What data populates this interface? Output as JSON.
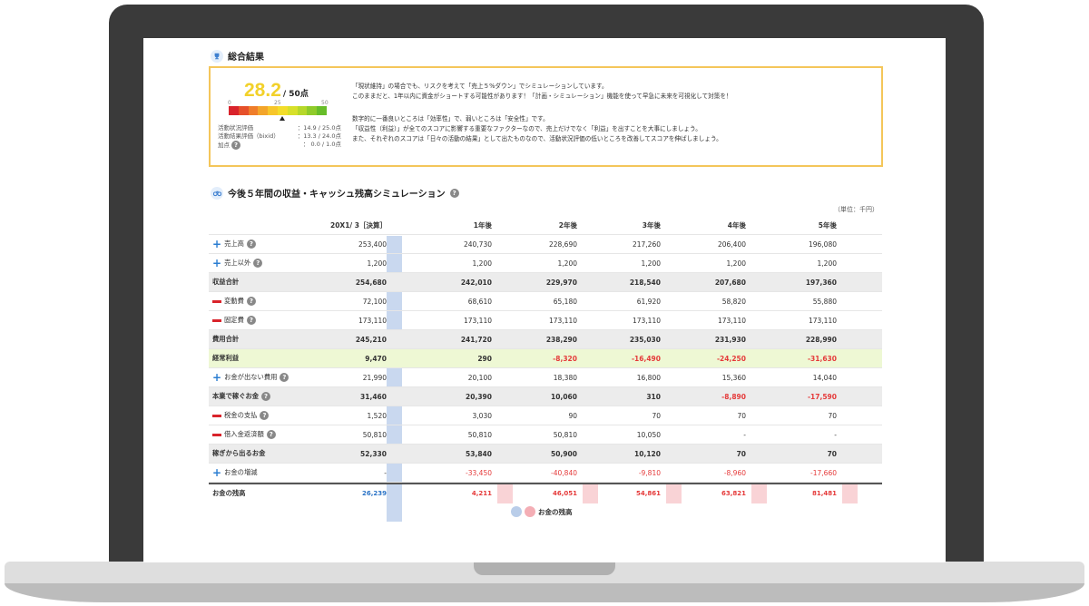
{
  "summary": {
    "section_title": "総合結果",
    "score": "28.2",
    "score_max": "/ 50点",
    "gauge_labels": [
      "0",
      "25",
      "50"
    ],
    "gauge_colors": [
      "#d9232b",
      "#e6502a",
      "#ef7d2a",
      "#f3a52a",
      "#f7c62a",
      "#f3dd2a",
      "#d7e02a",
      "#b6d82a",
      "#8fcb2a",
      "#67bd2a"
    ],
    "stats": [
      {
        "label": "活動状況評価",
        "value": "：14.9 / 25.0点"
      },
      {
        "label": "活動結果評価（bixid）",
        "value": "：13.3 / 24.0点"
      },
      {
        "label": "加点",
        "value": "：  0.0 /   1.0点"
      }
    ],
    "messages": [
      "「現状維持」の場合でも、リスクを考えて「売上５%ダウン」でシミュレーションしています。",
      "このままだと、1年以内に資金がショートする可能性があります！「計画・シミュレーション」機能を使って早急に未来を可視化して対策を！",
      "数字的に一番良いところは「効率性」で、弱いところは「安全性」です。",
      "「収益性（利益）」が全てのスコアに影響する重要なファクターなので、売上だけでなく「利益」を出すことを大事にしましょう。",
      "また、それぞれのスコアは「日々の活動の結果」として出たものなので、活動状況評価の低いところを改善してスコアを伸ばしましょう。"
    ]
  },
  "simulation": {
    "section_title": "今後５年間の収益・キャッシュ残高シミュレーション",
    "unit": "（単位：千円）",
    "columns": [
      "20X1/ 3［決算］",
      "1年後",
      "2年後",
      "3年後",
      "4年後",
      "5年後"
    ],
    "rows": [
      {
        "label": "売上高",
        "mark": "plus",
        "help": true,
        "style": "",
        "values": [
          "253,400",
          "240,730",
          "228,690",
          "217,260",
          "206,400",
          "196,080"
        ]
      },
      {
        "label": "売上以外",
        "mark": "plus",
        "help": true,
        "style": "",
        "values": [
          "1,200",
          "1,200",
          "1,200",
          "1,200",
          "1,200",
          "1,200"
        ]
      },
      {
        "label": "収益合計",
        "mark": "",
        "help": false,
        "style": "gray",
        "values": [
          "254,680",
          "242,010",
          "229,970",
          "218,540",
          "207,680",
          "197,360"
        ]
      },
      {
        "label": "変動費",
        "mark": "minus",
        "help": true,
        "style": "",
        "values": [
          "72,100",
          "68,610",
          "65,180",
          "61,920",
          "58,820",
          "55,880"
        ]
      },
      {
        "label": "固定費",
        "mark": "minus",
        "help": true,
        "style": "",
        "values": [
          "173,110",
          "173,110",
          "173,110",
          "173,110",
          "173,110",
          "173,110"
        ]
      },
      {
        "label": "費用合計",
        "mark": "",
        "help": false,
        "style": "gray",
        "values": [
          "245,210",
          "241,720",
          "238,290",
          "235,030",
          "231,930",
          "228,990"
        ]
      },
      {
        "label": "経常利益",
        "mark": "",
        "help": false,
        "style": "green",
        "values": [
          "9,470",
          "290",
          "-8,320",
          "-16,490",
          "-24,250",
          "-31,630"
        ]
      },
      {
        "label": "お金が出ない費用",
        "mark": "plus",
        "help": true,
        "style": "",
        "values": [
          "21,990",
          "20,100",
          "18,380",
          "16,800",
          "15,360",
          "14,040"
        ]
      },
      {
        "label": "本業で稼ぐお金",
        "mark": "",
        "help": true,
        "style": "gray",
        "values": [
          "31,460",
          "20,390",
          "10,060",
          "310",
          "-8,890",
          "-17,590"
        ]
      },
      {
        "label": "税金の支払",
        "mark": "minus",
        "help": true,
        "style": "",
        "values": [
          "1,520",
          "3,030",
          "90",
          "70",
          "70",
          "70"
        ]
      },
      {
        "label": "借入金返済額",
        "mark": "minus",
        "help": true,
        "style": "",
        "values": [
          "50,810",
          "50,810",
          "50,810",
          "10,050",
          "-",
          "-"
        ]
      },
      {
        "label": "稼ぎから出るお金",
        "mark": "",
        "help": false,
        "style": "gray",
        "values": [
          "52,330",
          "53,840",
          "50,900",
          "10,120",
          "70",
          "70"
        ]
      },
      {
        "label": "お金の増減",
        "mark": "plus",
        "help": false,
        "style": "",
        "values": [
          "-",
          "-33,450",
          "-40,840",
          "-9,810",
          "-8,960",
          "-17,660"
        ]
      },
      {
        "label": "お金の残高",
        "mark": "",
        "help": false,
        "style": "last",
        "values": [
          "26,239",
          "4,211",
          "46,051",
          "54,861",
          "63,821",
          "81,481"
        ]
      }
    ],
    "legend_label": "お金の残高",
    "legend_colors": [
      "#b9cde9",
      "#f4aeb5"
    ]
  }
}
